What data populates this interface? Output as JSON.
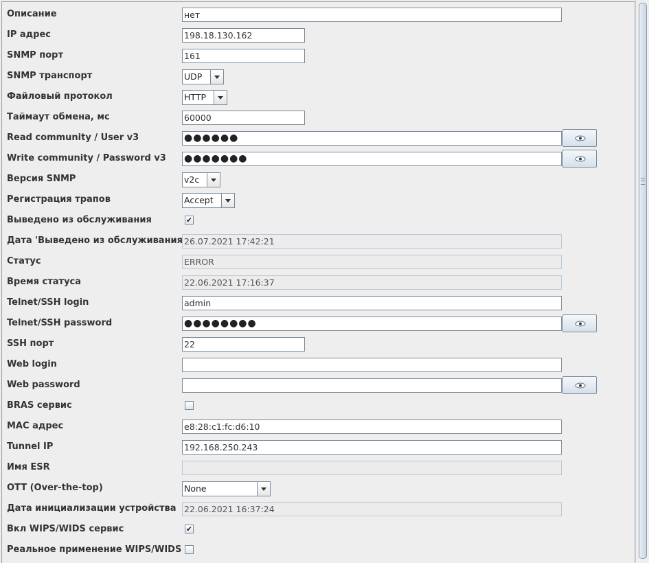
{
  "fields": {
    "description": {
      "label": "Описание",
      "value": "нет"
    },
    "ip_address": {
      "label": "IP адрес",
      "value": "198.18.130.162"
    },
    "snmp_port": {
      "label": "SNMP порт",
      "value": "161"
    },
    "snmp_transport": {
      "label": "SNMP транспорт",
      "value": "UDP"
    },
    "file_protocol": {
      "label": "Файловый протокол",
      "value": "HTTP"
    },
    "timeout": {
      "label": "Таймаут обмена, мс",
      "value": "60000"
    },
    "read_community": {
      "label": "Read community / User v3",
      "value": "●●●●●●"
    },
    "write_community": {
      "label": "Write community / Password v3",
      "value": "●●●●●●●"
    },
    "snmp_version": {
      "label": "Версия SNMP",
      "value": "v2c"
    },
    "trap_registration": {
      "label": "Регистрация трапов",
      "value": "Accept"
    },
    "decommissioned": {
      "label": "Выведено из обслуживания",
      "checked": true
    },
    "decommission_date": {
      "label": "Дата 'Выведено из обслуживания'",
      "value": "26.07.2021 17:42:21"
    },
    "status": {
      "label": "Статус",
      "value": "ERROR"
    },
    "status_time": {
      "label": "Время статуса",
      "value": "22.06.2021 17:16:37"
    },
    "telnet_login": {
      "label": "Telnet/SSH login",
      "value": "admin"
    },
    "telnet_password": {
      "label": "Telnet/SSH password",
      "value": "●●●●●●●●"
    },
    "ssh_port": {
      "label": "SSH порт",
      "value": "22"
    },
    "web_login": {
      "label": "Web login",
      "value": ""
    },
    "web_password": {
      "label": "Web password",
      "value": ""
    },
    "bras_service": {
      "label": "BRAS сервис",
      "checked": false
    },
    "mac_address": {
      "label": "MAC адрес",
      "value": "e8:28:c1:fc:d6:10"
    },
    "tunnel_ip": {
      "label": "Tunnel IP",
      "value": "192.168.250.243"
    },
    "esr_name": {
      "label": "Имя ESR",
      "value": ""
    },
    "ott": {
      "label": "OTT (Over-the-top)",
      "value": "None"
    },
    "init_date": {
      "label": "Дата инициализации устройства",
      "value": "22.06.2021 16:37:24"
    },
    "wips_service": {
      "label": "Вкл WIPS/WIDS сервис",
      "checked": true
    },
    "wips_real": {
      "label": "Реальное применение WIPS/WIDS",
      "checked": false
    }
  },
  "icons": {
    "show_password": "eye-icon",
    "combo_arrow": "chevron-down-icon",
    "check": "checkmark-icon"
  },
  "colors": {
    "background": "#eeeeee",
    "field_border": "#7a8a99",
    "readonly_field": "#ececec"
  }
}
